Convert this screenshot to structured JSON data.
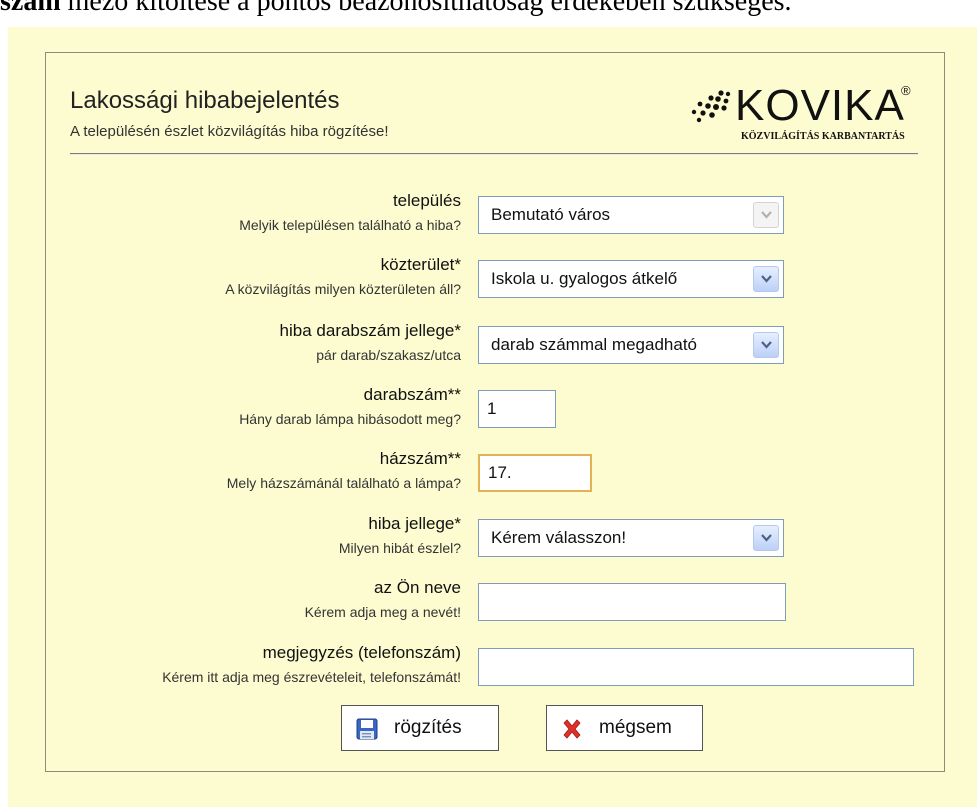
{
  "caption": {
    "bold": "szám",
    "rest": " mező kitöltése a pontos beazonosíthatóság érdekében szükséges."
  },
  "form": {
    "title": "Lakossági hibabejelentés",
    "subtitle": "A településén észlet közvilágítás hiba rögzítése!",
    "logo": {
      "word": "KOVIKA",
      "reg": "®",
      "tagline": "KÖZVILÁGÍTÁS KARBANTARTÁS"
    },
    "fields": [
      {
        "label": "település",
        "hint": "Melyik településen található a hiba?",
        "type": "select",
        "value": "Bemutató város",
        "disabled": true
      },
      {
        "label": "közterület*",
        "hint": "A közvilágítás milyen közterületen áll?",
        "type": "select",
        "value": "Iskola u. gyalogos átkelő"
      },
      {
        "label": "hiba darabszám jellege*",
        "hint": "pár darab/szakasz/utca",
        "type": "select",
        "value": "darab számmal megadható"
      },
      {
        "label": "darabszám**",
        "hint": "Hány darab lámpa hibásodott meg?",
        "type": "text",
        "value": "1"
      },
      {
        "label": "házszám**",
        "hint": "Mely házszámánál található a lámpa?",
        "type": "text",
        "value": "17."
      },
      {
        "label": "hiba jellege*",
        "hint": "Milyen hibát észlel?",
        "type": "select",
        "value": "Kérem válasszon!"
      },
      {
        "label": "az Ön neve",
        "hint": "Kérem adja meg a nevét!",
        "type": "text",
        "value": ""
      },
      {
        "label": "megjegyzés (telefonszám)",
        "hint": "Kérem itt adja meg észrevételeit, telefonszámát!",
        "type": "text",
        "value": ""
      }
    ],
    "buttons": {
      "save": "rögzítés",
      "cancel": "mégsem"
    }
  },
  "icons": {
    "save": "floppy-disk-icon",
    "cancel": "red-x-icon",
    "dropdown": "chevron-down-icon"
  },
  "colors": {
    "page_background": "#fdfcd0",
    "focus_border": "#e3b252",
    "input_border": "#7f9db9",
    "cancel_red": "#e0302a"
  }
}
